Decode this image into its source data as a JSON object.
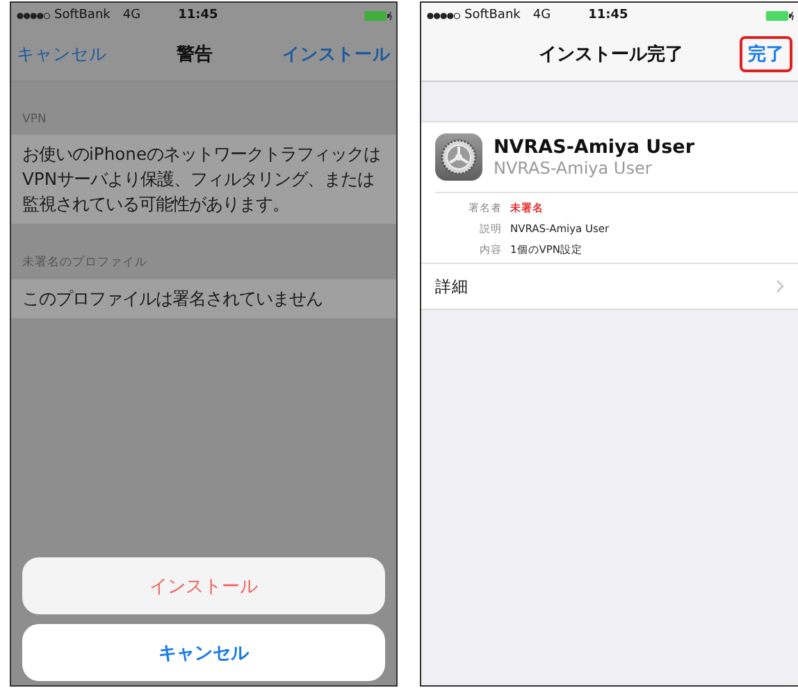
{
  "warning_screen": {
    "status_bar": {
      "carrier": "SoftBank",
      "network": "4G",
      "time": "11:45"
    },
    "nav": {
      "left": "キャンセル",
      "title": "警告",
      "right": "インストール"
    },
    "sections": [
      {
        "header": "VPN",
        "text": "お使いのiPhoneのネットワークトラフィックはVPNサーバより保護、フィルタリング、または監視されている可能性があります。"
      },
      {
        "header": "未署名のプロファイル",
        "text": "このプロファイルは署名されていません"
      }
    ],
    "action_sheet": [
      {
        "label": "インストール",
        "kind": "destructive"
      },
      {
        "label": "キャンセル",
        "kind": "cancel"
      }
    ]
  },
  "installed_screen": {
    "status_bar": {
      "carrier": "SoftBank",
      "network": "4G",
      "time": "11:45"
    },
    "nav": {
      "title": "インストール完了",
      "done": "完了",
      "highlighted": true
    },
    "profile": {
      "name": "NVRAS-Amiya User",
      "subtitle": "NVRAS-Amiya User"
    },
    "details": [
      {
        "label": "署名者",
        "value": "未署名",
        "warning": true
      },
      {
        "label": "説明",
        "value": "NVRAS-Amiya User",
        "warning": false
      },
      {
        "label": "内容",
        "value": "1個のVPN設定",
        "warning": false
      }
    ],
    "more": {
      "label": "詳細"
    }
  }
}
